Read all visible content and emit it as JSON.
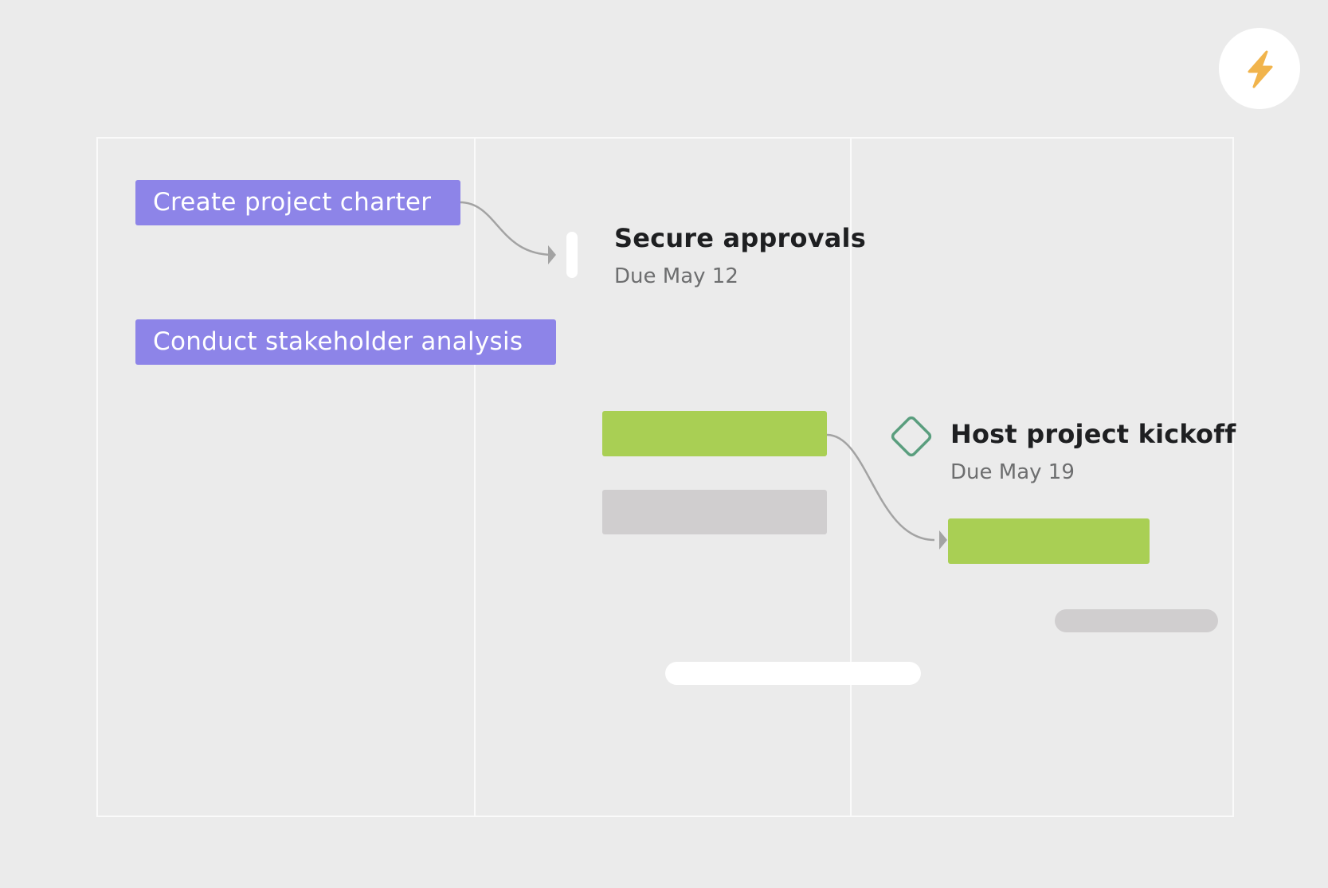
{
  "tasks": [
    {
      "label": "Create project charter"
    },
    {
      "label": "Conduct stakeholder analysis"
    }
  ],
  "milestones": [
    {
      "title": "Secure approvals",
      "due": "Due May 12"
    },
    {
      "title": "Host project kickoff",
      "due": "Due May 19"
    }
  ],
  "colors": {
    "task_purple": "#8d84e8",
    "bar_green": "#a9cf54",
    "bar_grey": "#d0cecf",
    "milestone_diamond": "#5a9e7e",
    "bolt": "#f1b44c"
  },
  "icons": {
    "action_button": "lightning-bolt-icon",
    "milestone": "diamond-icon"
  }
}
